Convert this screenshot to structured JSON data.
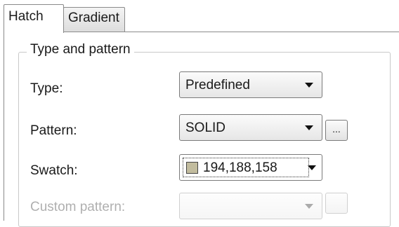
{
  "tabs": [
    {
      "label": "Hatch",
      "active": true
    },
    {
      "label": "Gradient",
      "active": false
    }
  ],
  "group": {
    "title": "Type and pattern"
  },
  "fields": {
    "type": {
      "label": "Type:",
      "value": "Predefined"
    },
    "pattern": {
      "label": "Pattern:",
      "value": "SOLID",
      "browse_label": "..."
    },
    "swatch": {
      "label": "Swatch:",
      "value": "194,188,158",
      "color": "#c2bc9e"
    },
    "custom_pattern": {
      "label": "Custom pattern:"
    }
  },
  "icons": {
    "dropdown": "chevron-down-icon",
    "color_chip": "color-swatch-icon"
  }
}
